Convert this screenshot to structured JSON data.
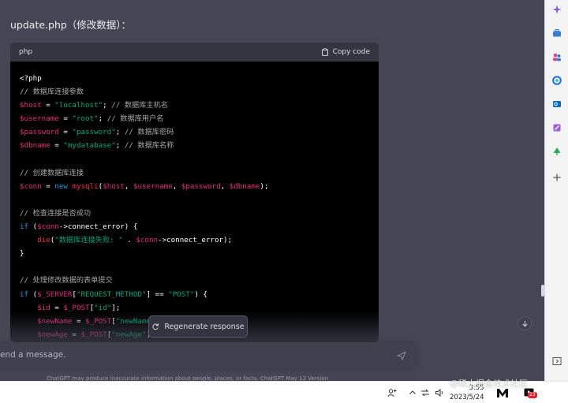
{
  "heading": "update.php（修改数据）：",
  "code_block": {
    "language": "php",
    "copy_label": "Copy code"
  },
  "code_lines": [
    "<?php",
    "// 数据库连接参数",
    "$host = \"localhost\"; // 数据库主机名",
    "$username = \"root\"; // 数据库用户名",
    "$password = \"password\"; // 数据库密码",
    "$dbname = \"mydatabase\"; // 数据库名称",
    "",
    "// 创建数据库连接",
    "$conn = new mysqli($host, $username, $password, $dbname);",
    "",
    "// 检查连接是否成功",
    "if ($conn->connect_error) {",
    "    die(\"数据库连接失败: \" . $conn->connect_error);",
    "}",
    "",
    "// 处理修改数据的表单提交",
    "if ($_SERVER[\"REQUEST_METHOD\"] == \"POST\") {",
    "    $id = $_POST[\"id\"];",
    "    $newName = $_POST[\"newName\"];",
    "    $newAge = $_POST[\"newAge\"];"
  ],
  "regenerate_label": "Regenerate response",
  "input_placeholder": "end a message.",
  "disclaimer": "ChatGPT may produce inaccurate information about people, places, or facts. ChatGPT May 12 Version",
  "taskbar": {
    "time": "3:55",
    "date": "2023/5/24",
    "notification_count": "23"
  },
  "watermark": "@稀土掘金技术社区",
  "colors": {
    "background": "#444654",
    "code_bg": "#000000",
    "comment": "#a8a8a8",
    "variable": "#df3079",
    "string": "#00a67d",
    "keyword": "#2e95d3"
  },
  "icons": {
    "copy": "clipboard-icon",
    "regenerate": "refresh-icon",
    "send": "paper-plane-icon",
    "scroll_down": "arrow-down-icon"
  }
}
